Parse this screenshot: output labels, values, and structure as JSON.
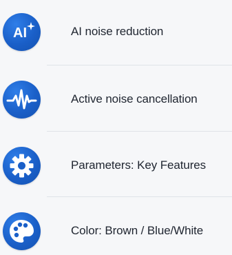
{
  "features": [
    {
      "icon": "ai-sparkle-icon",
      "icon_text": "AI",
      "label": "AI noise reduction"
    },
    {
      "icon": "waveform-icon",
      "label": "Active noise cancellation"
    },
    {
      "icon": "gear-icon",
      "label": "Parameters: Key Features"
    },
    {
      "icon": "palette-icon",
      "label": "Color: Brown / Blue/White"
    }
  ],
  "colors": {
    "icon_background": "#1a5fc8",
    "icon_foreground": "#ffffff",
    "label_text": "#1f2530",
    "divider": "#dfe3e8",
    "page_background": "#f6f7f9"
  }
}
